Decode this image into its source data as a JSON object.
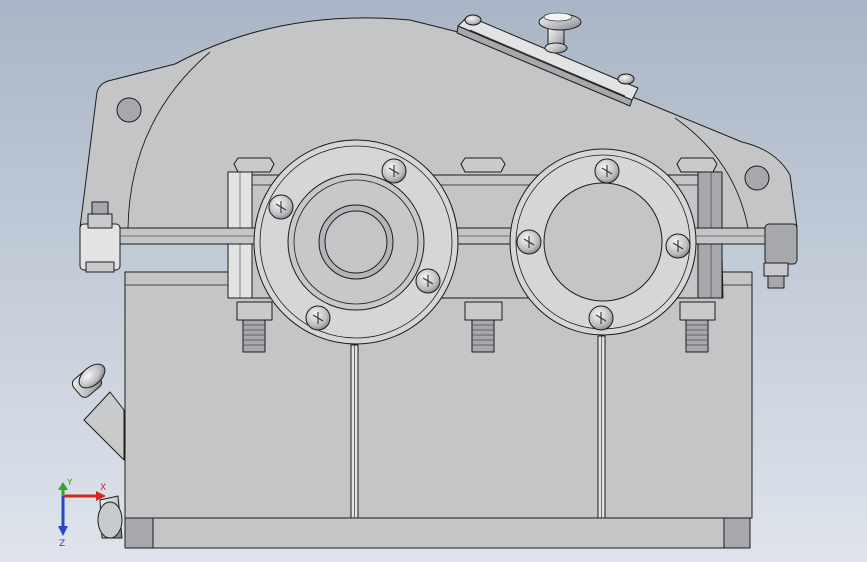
{
  "viewport": {
    "background_top": "#a9b5c6",
    "background_bottom": "#dfe4ec"
  },
  "model": {
    "body_color": "#c4c5c7",
    "edge_color": "#1c1c1c",
    "shade_color": "#a7a8ab",
    "highlight_color": "#e2e3e5",
    "dark_color": "#6c6d70"
  },
  "triad": {
    "x_label": "X",
    "y_label": "Y",
    "z_label": "Z",
    "x_color": "#d9261c",
    "y_color": "#2fa52f",
    "z_color": "#2a45c8"
  }
}
